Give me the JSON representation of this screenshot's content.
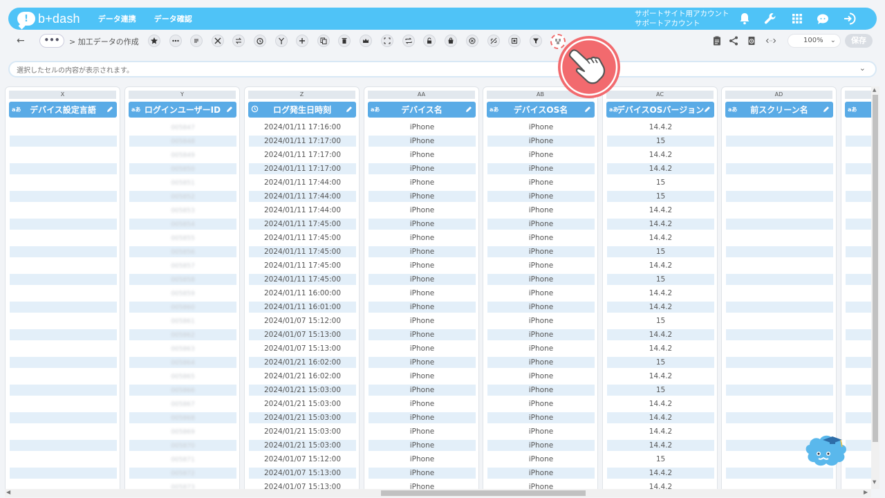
{
  "header": {
    "logo_text": "b+dash",
    "nav": [
      "データ連携",
      "データ確認"
    ],
    "account_line1": "サポートサイト用アカウント",
    "account_line2": "サポートアカウント",
    "icons": [
      "bell-icon",
      "wrench-icon",
      "apps-grid-icon",
      "support-chat-icon",
      "logout-icon"
    ]
  },
  "toolbar": {
    "more_label": "•••",
    "breadcrumb": "> 加工データの作成",
    "tool_icons": [
      "star-icon",
      "more-dots-icon",
      "list-icon",
      "tools-icon",
      "split-icon",
      "timer-icon",
      "branch-icon",
      "plus-icon",
      "copy-icon",
      "trash-icon",
      "crown-icon",
      "expand-icon",
      "repeat-icon",
      "lock-icon",
      "bag-icon",
      "close-circle-icon",
      "no-link-icon",
      "frame-icon",
      "filter-icon",
      "split-column-icon"
    ],
    "highlighted_tool": "split-column-icon",
    "right_icons": [
      "clipboard-icon",
      "share-icon",
      "history-icon",
      "code-icon"
    ],
    "zoom": "100%",
    "save_label": "保存"
  },
  "cellbar": {
    "placeholder": "選択したセルの内容が表示されます。"
  },
  "columns": [
    {
      "letter": "X",
      "name": "デバイス設定言語",
      "type": "あ",
      "kind": "empty"
    },
    {
      "letter": "Y",
      "name": "ログインユーザーID",
      "type": "あ",
      "kind": "blurred"
    },
    {
      "letter": "Z",
      "name": "ログ発生日時刻",
      "type": "clock",
      "kind": "datetime"
    },
    {
      "letter": "AA",
      "name": "デバイス名",
      "type": "あ",
      "kind": "device"
    },
    {
      "letter": "AB",
      "name": "デバイスOS名",
      "type": "あ",
      "kind": "device"
    },
    {
      "letter": "AC",
      "name": "デバイスOSバージョン",
      "type": "あ",
      "kind": "version"
    },
    {
      "letter": "AD",
      "name": "前スクリーン名",
      "type": "あ",
      "kind": "empty"
    },
    {
      "letter": "",
      "name": "",
      "type": "あ",
      "kind": "empty"
    }
  ],
  "rows": {
    "user_ids": [
      "005847",
      "005848",
      "005849",
      "005850",
      "005851",
      "005852",
      "005853",
      "005854",
      "005855",
      "005856",
      "005857",
      "005858",
      "005859",
      "005860",
      "005861",
      "005862",
      "005863",
      "005864",
      "005865",
      "005866",
      "005867",
      "005868",
      "005869",
      "005870",
      "005871",
      "005872",
      "005873"
    ],
    "datetimes": [
      "2024/01/11 17:16:00",
      "2024/01/11 17:17:00",
      "2024/01/11 17:17:00",
      "2024/01/11 17:17:00",
      "2024/01/11 17:44:00",
      "2024/01/11 17:44:00",
      "2024/01/11 17:44:00",
      "2024/01/11 17:45:00",
      "2024/01/11 17:45:00",
      "2024/01/11 17:45:00",
      "2024/01/11 17:45:00",
      "2024/01/11 17:45:00",
      "2024/01/11 16:00:00",
      "2024/01/11 16:01:00",
      "2024/01/07 15:12:00",
      "2024/01/07 15:13:00",
      "2024/01/07 15:13:00",
      "2024/01/21 16:02:00",
      "2024/01/21 16:02:00",
      "2024/01/21 15:03:00",
      "2024/01/21 15:03:00",
      "2024/01/21 15:03:00",
      "2024/01/21 15:03:00",
      "2024/01/21 15:03:00",
      "2024/01/07 15:12:00",
      "2024/01/07 15:13:00",
      "2024/01/07 15:13:00"
    ],
    "device": "iPhone",
    "versions": [
      "14.4.2",
      "15",
      "14.4.2",
      "14.4.2",
      "15",
      "15",
      "14.4.2",
      "14.4.2",
      "14.4.2",
      "15",
      "14.4.2",
      "15",
      "14.4.2",
      "14.4.2",
      "15",
      "14.4.2",
      "14.4.2",
      "15",
      "14.4.2",
      "15",
      "14.4.2",
      "14.4.2",
      "14.4.2",
      "14.4.2",
      "15",
      "14.4.2",
      "14.4.2"
    ]
  }
}
